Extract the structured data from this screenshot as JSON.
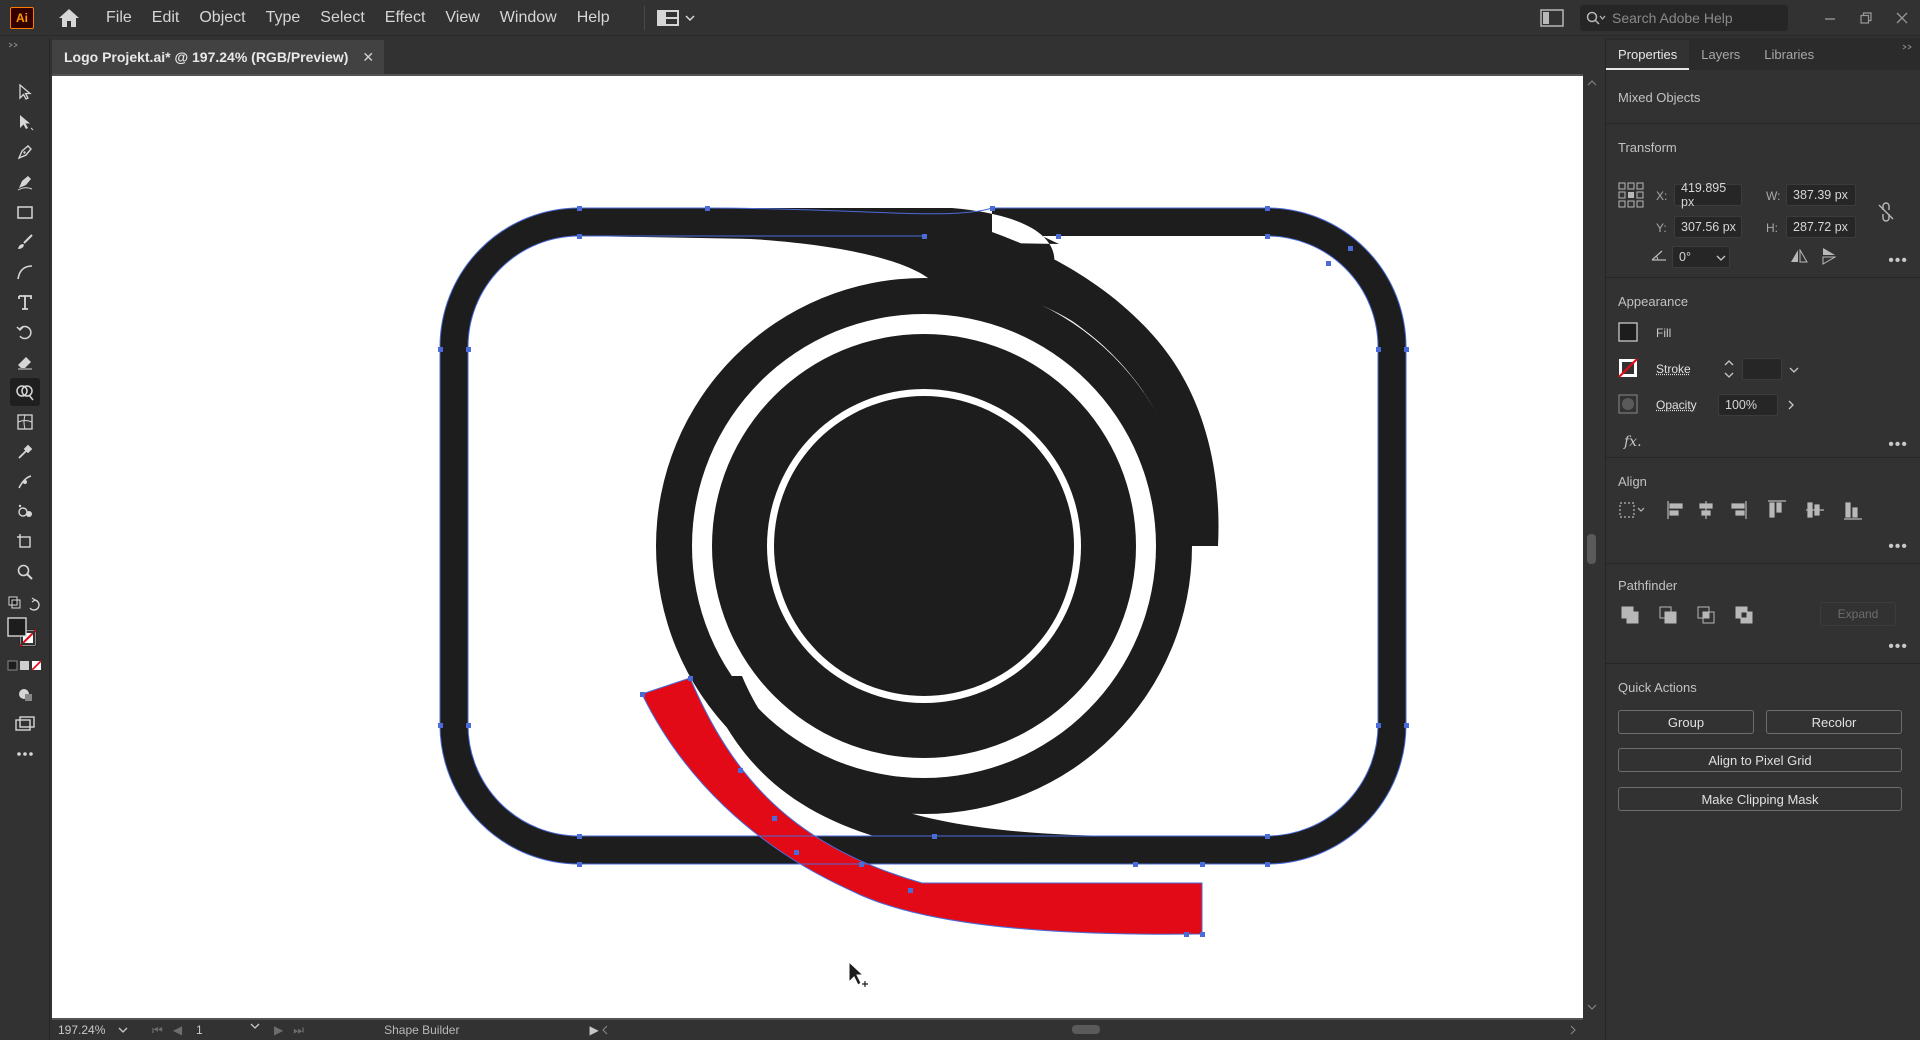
{
  "app": {
    "logo": "Ai",
    "menu": [
      "File",
      "Edit",
      "Object",
      "Type",
      "Select",
      "Effect",
      "View",
      "Window",
      "Help"
    ],
    "search_placeholder": "Search Adobe Help"
  },
  "document": {
    "tab_title": "Logo Projekt.ai* @ 197.24% (RGB/Preview)",
    "close_glyph": "✕"
  },
  "status": {
    "zoom": "197.24%",
    "page": "1",
    "tool": "Shape Builder"
  },
  "panel": {
    "tabs": [
      "Properties",
      "Layers",
      "Libraries"
    ],
    "selection": "Mixed Objects",
    "transform": {
      "title": "Transform",
      "x_label": "X:",
      "x": "419.895 px",
      "y_label": "Y:",
      "y": "307.56 px",
      "w_label": "W:",
      "w": "387.39 px",
      "h_label": "H:",
      "h": "287.72 px",
      "angle": "0°"
    },
    "appearance": {
      "title": "Appearance",
      "fill": "Fill",
      "stroke": "Stroke",
      "opacity_label": "Opacity",
      "opacity": "100%",
      "fx": "fx."
    },
    "align": {
      "title": "Align"
    },
    "pathfinder": {
      "title": "Pathfinder",
      "expand": "Expand"
    },
    "quick_actions": {
      "title": "Quick Actions",
      "group": "Group",
      "recolor": "Recolor",
      "align_pixel": "Align to Pixel Grid",
      "clipping": "Make Clipping Mask"
    }
  },
  "colors": {
    "logo_black": "#1d1d1d",
    "logo_red": "#e20a17",
    "selection_blue": "#4a6bd8"
  }
}
